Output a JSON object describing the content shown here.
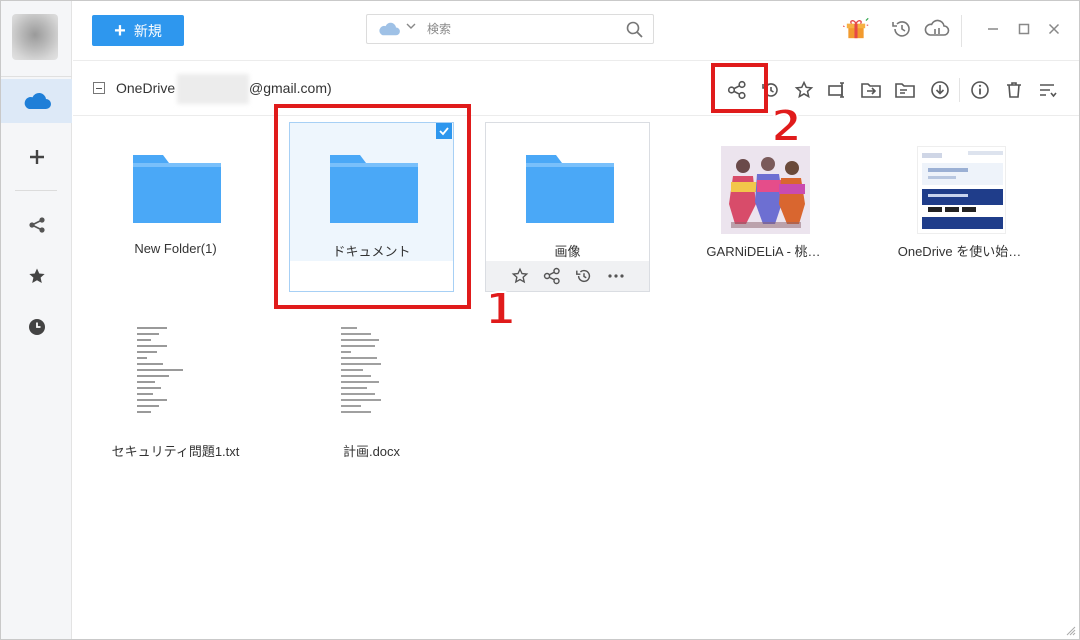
{
  "toolbar": {
    "new_label": "新規",
    "search_placeholder": "検索"
  },
  "pathbar": {
    "drive_label": "OneDrive",
    "email_suffix": "@gmail.com)"
  },
  "colors": {
    "accent": "#2e97ee",
    "folder": "#4aa8f7",
    "annotation": "#e01b1b"
  },
  "sidebar": {
    "items": [
      {
        "name": "onedrive",
        "icon": "cloud-icon",
        "active": true
      },
      {
        "name": "add",
        "icon": "plus-icon"
      },
      {
        "name": "share",
        "icon": "share-icon"
      },
      {
        "name": "favorites",
        "icon": "star-icon"
      },
      {
        "name": "recent",
        "icon": "clock-icon"
      }
    ]
  },
  "files": [
    {
      "name": "New Folder(1)",
      "type": "folder"
    },
    {
      "name": "ドキュメント",
      "type": "folder",
      "selected": true
    },
    {
      "name": "画像",
      "type": "folder",
      "hovered": true
    },
    {
      "name": "GARNiDELiA - 桃…",
      "type": "image"
    },
    {
      "name": "OneDrive を使い始…",
      "type": "image"
    },
    {
      "name": "セキュリティ問題1.txt",
      "type": "txt"
    },
    {
      "name": "計画.docx",
      "type": "docx"
    }
  ],
  "annotations": {
    "step1": "1",
    "step2": "2"
  }
}
